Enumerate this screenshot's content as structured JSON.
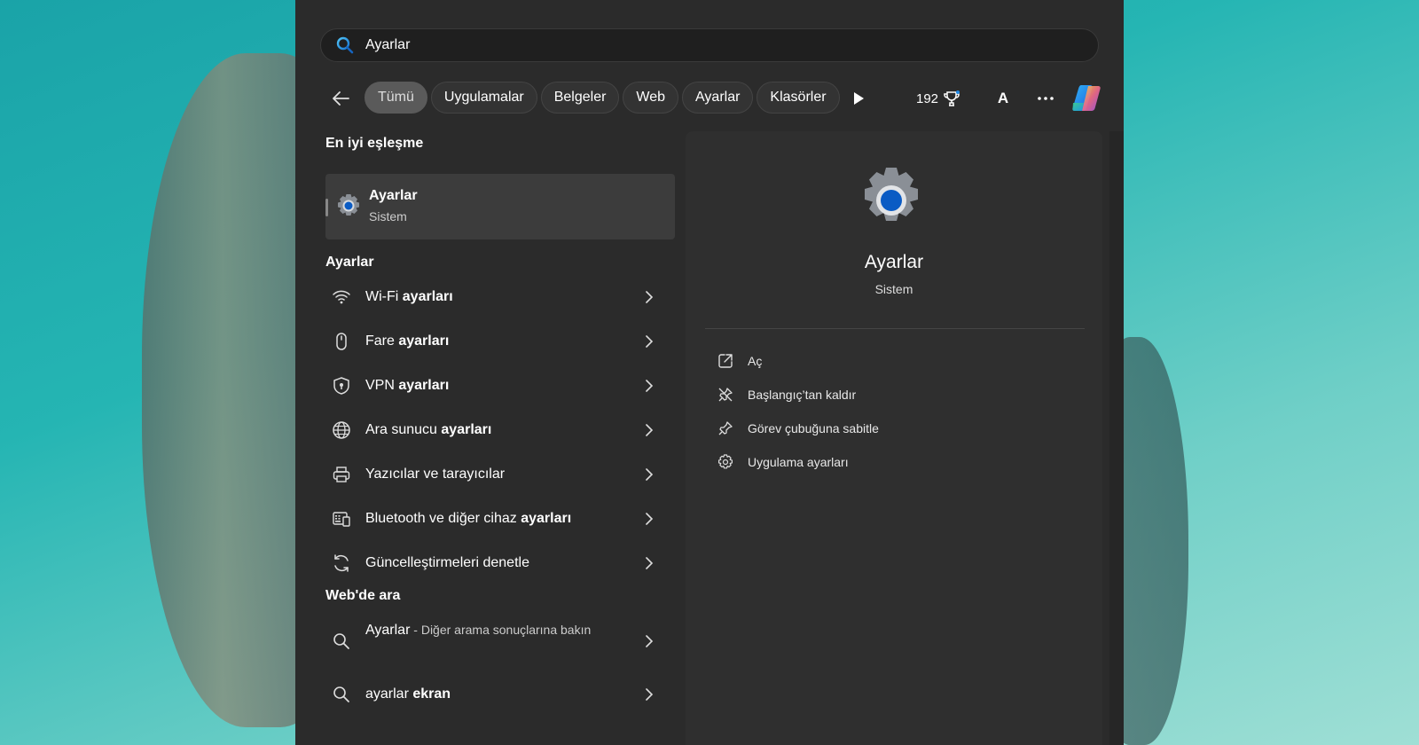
{
  "search": {
    "value": "Ayarlar"
  },
  "filters": {
    "chips": [
      "Tümü",
      "Uygulamalar",
      "Belgeler",
      "Web",
      "Ayarlar",
      "Klasörler"
    ],
    "points": "192",
    "avatar": "A"
  },
  "best_match": {
    "heading": "En iyi eşleşme",
    "title": "Ayarlar",
    "subtitle": "Sistem"
  },
  "settings_section": {
    "heading": "Ayarlar",
    "items": [
      {
        "pre": "Wi-Fi ",
        "bold": "ayarları",
        "icon": "wifi-icon"
      },
      {
        "pre": "Fare ",
        "bold": "ayarları",
        "icon": "mouse-icon"
      },
      {
        "pre": "VPN ",
        "bold": "ayarları",
        "icon": "shield-icon"
      },
      {
        "pre": "Ara sunucu ",
        "bold": "ayarları",
        "icon": "globe-icon"
      },
      {
        "pre": "Yazıcılar ve tarayıcılar",
        "bold": "",
        "icon": "printer-icon"
      },
      {
        "pre": "Bluetooth ve diğer cihaz ",
        "bold": "ayarları",
        "icon": "keyboard-device-icon"
      },
      {
        "pre": "Güncelleştirmeleri denetle",
        "bold": "",
        "icon": "refresh-icon"
      }
    ]
  },
  "web_section": {
    "heading": "Web'de ara",
    "items": [
      {
        "main": "Ayarlar",
        "detail": " - Diğer arama sonuçlarına bakın"
      },
      {
        "pre": "ayarlar ",
        "bold": "ekran"
      }
    ]
  },
  "detail": {
    "title": "Ayarlar",
    "category": "Sistem",
    "actions": [
      {
        "label": "Aç",
        "icon": "open-external-icon"
      },
      {
        "label": "Başlangıç’tan kaldır",
        "icon": "unpin-icon"
      },
      {
        "label": "Görev çubuğuna sabitle",
        "icon": "pin-icon"
      },
      {
        "label": "Uygulama ayarları",
        "icon": "gear-icon"
      }
    ]
  },
  "colors": {
    "panel": "#2b2b2b",
    "accent": "#0a5bc4",
    "chip_active": "#5a5a5a"
  }
}
